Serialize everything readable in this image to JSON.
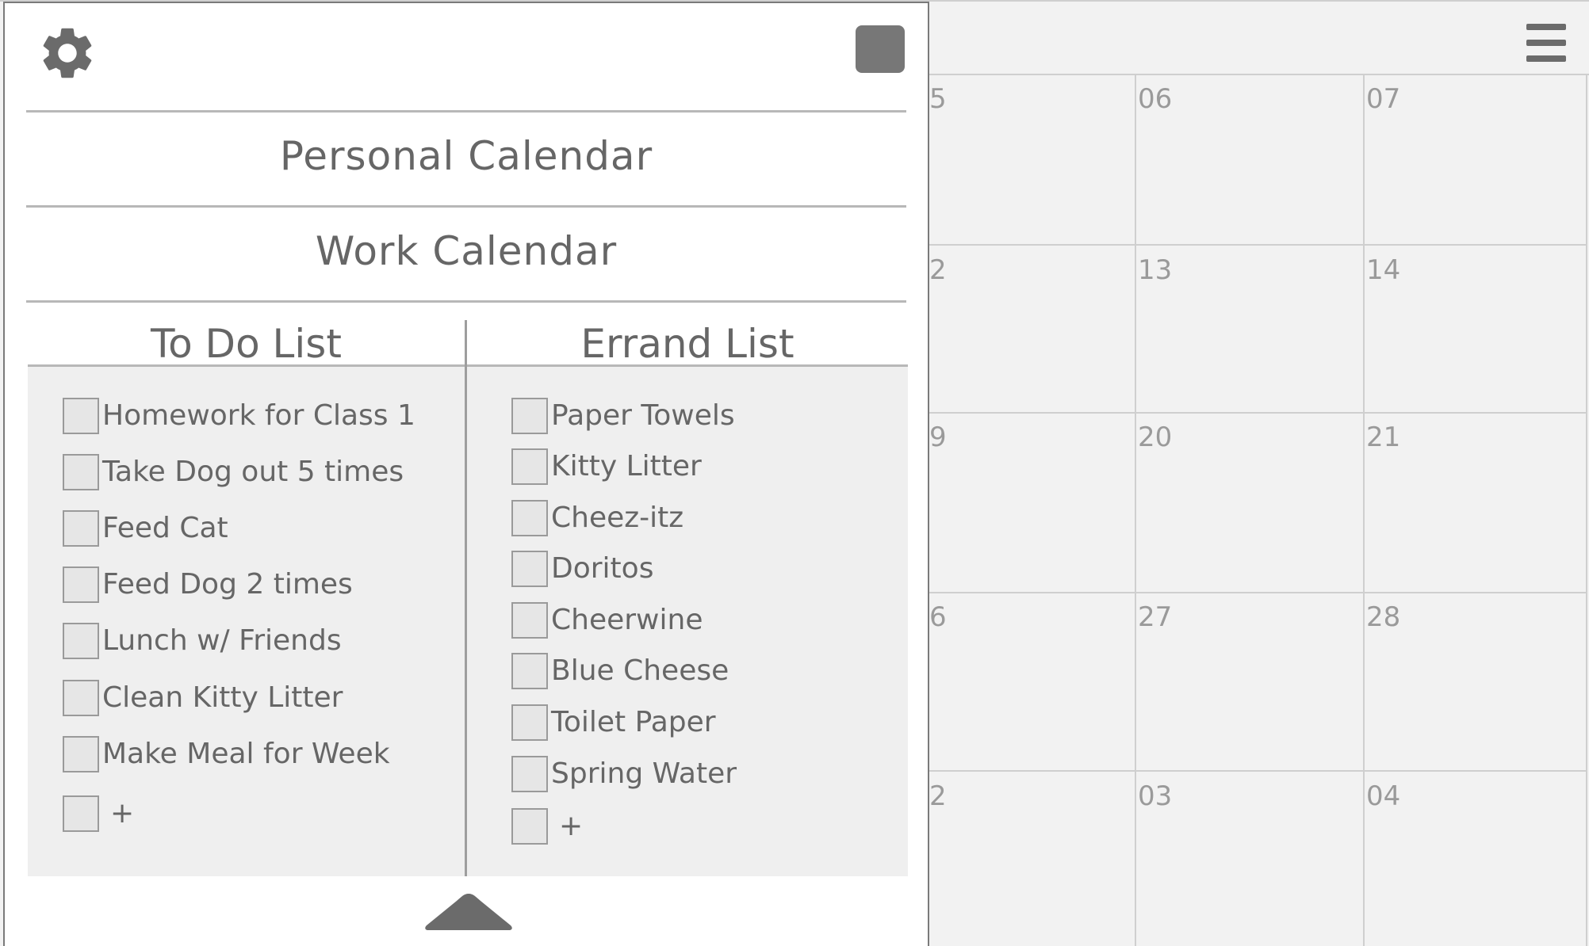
{
  "calendar": {
    "columns": [
      {
        "days": [
          "5",
          "2",
          "9",
          "6",
          "2"
        ]
      },
      {
        "days": [
          "06",
          "13",
          "20",
          "27",
          "03"
        ]
      },
      {
        "days": [
          "07",
          "14",
          "21",
          "28",
          "04"
        ]
      }
    ],
    "menu_icon": "hamburger-menu-icon"
  },
  "panel": {
    "settings_icon": "gear-icon",
    "calendars": [
      "Personal Calendar",
      "Work Calendar"
    ],
    "todo": {
      "heading": "To Do List",
      "items": [
        "Homework for Class 1",
        "Take Dog out 5 times",
        "Feed Cat",
        "Feed Dog 2 times",
        "Lunch w/ Friends",
        "Clean Kitty Litter",
        "Make Meal for Week"
      ],
      "add_label": "+"
    },
    "errands": {
      "heading": "Errand List",
      "items": [
        "Paper Towels",
        "Kitty Litter",
        "Cheez-itz",
        "Doritos",
        "Cheerwine",
        "Blue Cheese",
        "Toilet Paper",
        "Spring Water"
      ],
      "add_label": "+"
    },
    "collapse_icon": "triangle-up-icon"
  },
  "colors": {
    "panel_bg": "#ffffff",
    "calendar_bg": "#f2f2f2",
    "list_bg": "#efefef",
    "icon": "#6b6b6b"
  }
}
